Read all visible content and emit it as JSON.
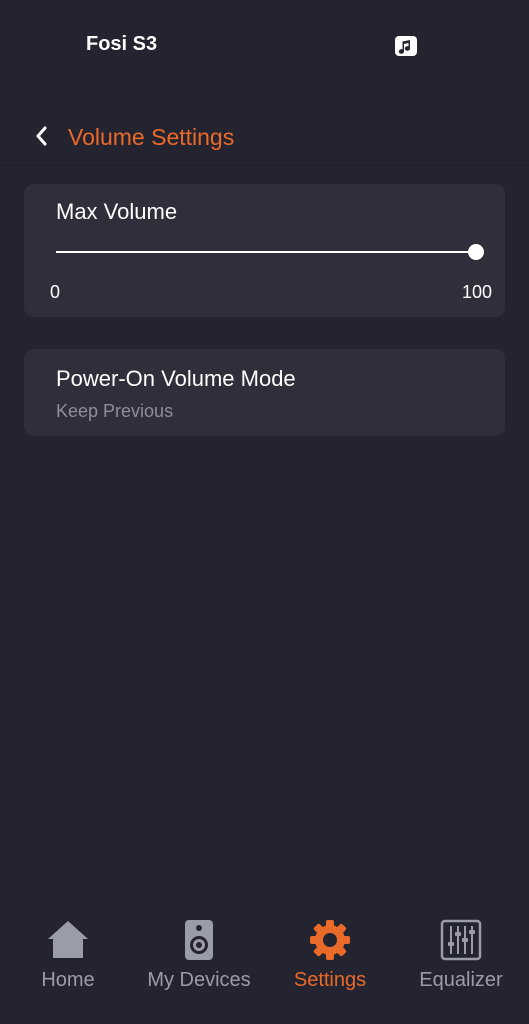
{
  "header": {
    "device_name": "Fosi S3",
    "music_icon": "music-note-icon"
  },
  "navbar": {
    "back_icon": "chevron-left-icon",
    "title": "Volume Settings"
  },
  "max_volume": {
    "title": "Max Volume",
    "min_label": "0",
    "max_label": "100",
    "value": 100,
    "min": 0,
    "max": 100
  },
  "power_on": {
    "title": "Power-On Volume Mode",
    "value": "Keep Previous"
  },
  "tabs": [
    {
      "label": "Home",
      "icon": "home-icon",
      "active": false
    },
    {
      "label": "My Devices",
      "icon": "speaker-icon",
      "active": false
    },
    {
      "label": "Settings",
      "icon": "gear-icon",
      "active": true
    },
    {
      "label": "Equalizer",
      "icon": "equalizer-icon",
      "active": false
    }
  ],
  "colors": {
    "background": "#23242f",
    "card": "#2e2f3b",
    "accent": "#ea6a2a",
    "inactive": "#9a9ca8"
  }
}
